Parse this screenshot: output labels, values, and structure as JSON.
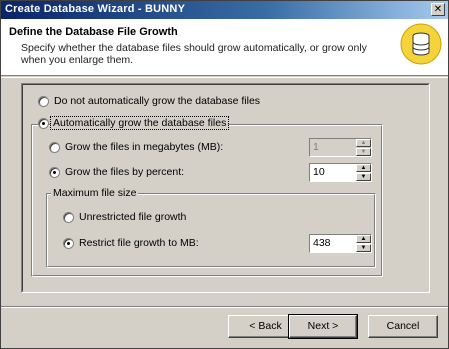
{
  "window": {
    "title": "Create Database Wizard - BUNNY",
    "close_glyph": "✕"
  },
  "header": {
    "title": "Define the Database File Growth",
    "description": "Specify whether the database files should grow automatically, or grow only when you enlarge them.",
    "icon": "database-cylinder-icon"
  },
  "options": {
    "no_auto_grow": {
      "label": "Do not automatically grow the database files",
      "selected": false
    },
    "auto_grow": {
      "label": "Automatically grow the database files",
      "selected": true
    },
    "grow_mb": {
      "label": "Grow the files in megabytes (MB):",
      "selected": false,
      "value": "1"
    },
    "grow_percent": {
      "label": "Grow the files by percent:",
      "selected": true,
      "value": "10"
    },
    "max_size": {
      "legend": "Maximum file size",
      "unrestricted": {
        "label": "Unrestricted file growth",
        "selected": false
      },
      "restrict": {
        "label": "Restrict file growth to MB:",
        "selected": true,
        "value": "438"
      }
    }
  },
  "buttons": {
    "back": "< Back",
    "next": "Next >",
    "cancel": "Cancel"
  },
  "colors": {
    "title_bar_start": "#0a246a",
    "title_bar_end": "#a6caf0",
    "face": "#d4d0c8",
    "icon_yellow": "#f5d33a"
  }
}
